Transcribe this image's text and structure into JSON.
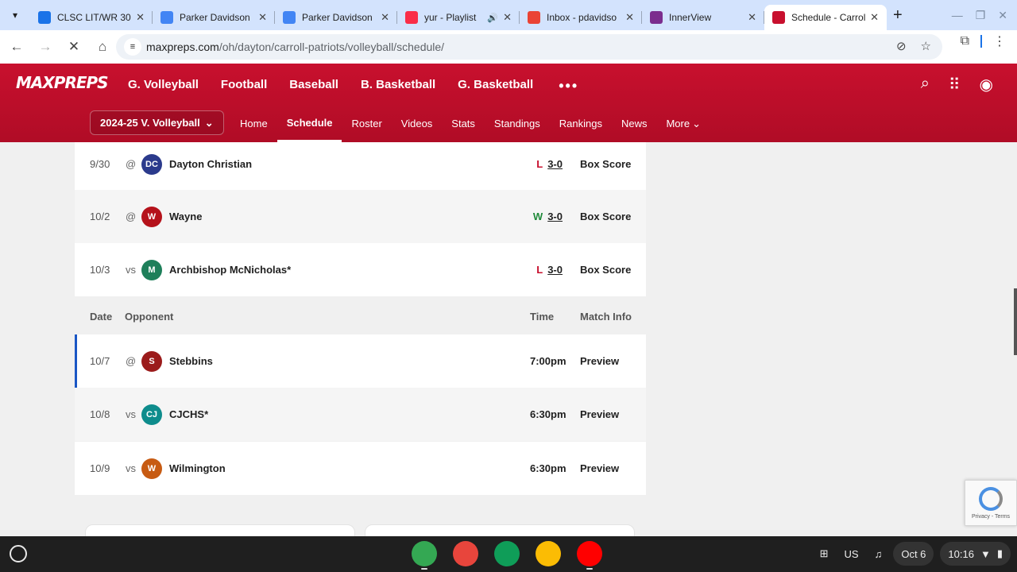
{
  "browser": {
    "tabs": [
      {
        "title": "CLSC LIT/WR 30",
        "fav_color": "#1a73e8",
        "fav_icon": "classroom-icon",
        "audio": false,
        "active": false
      },
      {
        "title": "Parker Davidson",
        "fav_color": "#4285f4",
        "fav_icon": "docs-icon",
        "audio": false,
        "active": false
      },
      {
        "title": "Parker Davidson",
        "fav_color": "#4285f4",
        "fav_icon": "docs-icon",
        "audio": false,
        "active": false
      },
      {
        "title": "yur - Playlist",
        "fav_color": "#fa2d48",
        "fav_icon": "music-icon",
        "audio": true,
        "active": false
      },
      {
        "title": "Inbox - pdavidso",
        "fav_color": "#ea4335",
        "fav_icon": "gmail-icon",
        "audio": false,
        "active": false
      },
      {
        "title": "InnerView",
        "fav_color": "#7b2d8e",
        "fav_icon": "innerview-icon",
        "audio": false,
        "active": false
      },
      {
        "title": "Schedule - Carroll",
        "fav_color": "#c8102e",
        "fav_icon": "maxpreps-icon",
        "audio": false,
        "active": true
      }
    ],
    "url_host": "maxpreps.com",
    "url_path": "/oh/dayton/carroll-patriots/volleyball/schedule/"
  },
  "header": {
    "logo": "MAXPREPS",
    "sports": [
      "G. Volleyball",
      "Football",
      "Baseball",
      "B. Basketball",
      "G. Basketball"
    ],
    "more_dots": "•••",
    "season": "2024-25 V. Volleyball",
    "subnav": [
      "Home",
      "Schedule",
      "Roster",
      "Videos",
      "Stats",
      "Standings",
      "Rankings",
      "News",
      "More"
    ],
    "active_subnav": "Schedule"
  },
  "schedule": {
    "past": [
      {
        "date": "9/30",
        "ha": "@",
        "opponent": "Dayton Christian",
        "logo_text": "DC",
        "logo_color": "#2b3a8c",
        "result": "L",
        "score": "3-0",
        "info": "Box Score"
      },
      {
        "date": "10/2",
        "ha": "@",
        "opponent": "Wayne",
        "logo_text": "W",
        "logo_color": "#b5121b",
        "result": "W",
        "score": "3-0",
        "info": "Box Score"
      },
      {
        "date": "10/3",
        "ha": "vs",
        "opponent": "Archbishop McNicholas*",
        "logo_text": "M",
        "logo_color": "#1e7f5a",
        "result": "L",
        "score": "3-0",
        "info": "Box Score"
      }
    ],
    "columns": {
      "date": "Date",
      "opponent": "Opponent",
      "time": "Time",
      "match_info": "Match Info"
    },
    "upcoming": [
      {
        "date": "10/7",
        "ha": "@",
        "opponent": "Stebbins",
        "logo_text": "S",
        "logo_color": "#9b1b1b",
        "time": "7:00pm",
        "info": "Preview",
        "current": true
      },
      {
        "date": "10/8",
        "ha": "vs",
        "opponent": "CJCHS*",
        "logo_text": "CJ",
        "logo_color": "#0e8c8c",
        "time": "6:30pm",
        "info": "Preview",
        "current": false
      },
      {
        "date": "10/9",
        "ha": "vs",
        "opponent": "Wilmington",
        "logo_text": "W",
        "logo_color": "#c75b12",
        "time": "6:30pm",
        "info": "Preview",
        "current": false
      }
    ]
  },
  "recaptcha": {
    "links": "Privacy - Terms"
  },
  "shelf": {
    "apps": [
      {
        "name": "chrome-icon",
        "color": "#34a853"
      },
      {
        "name": "canvas-icon",
        "color": "#e8453c"
      },
      {
        "name": "classroom-icon",
        "color": "#0f9d58"
      },
      {
        "name": "drive-icon",
        "color": "#fbbc04"
      },
      {
        "name": "youtube-icon",
        "color": "#ff0000"
      }
    ],
    "ime": "US",
    "date": "Oct 6",
    "time": "10:16"
  }
}
